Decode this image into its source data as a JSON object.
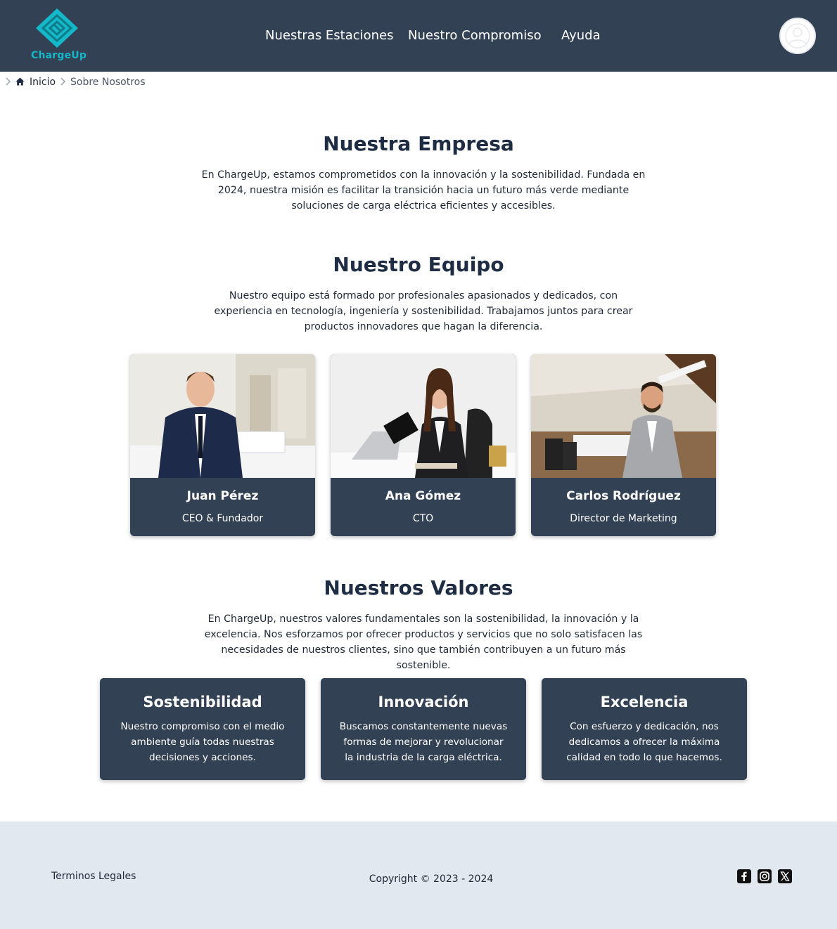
{
  "header": {
    "brand": "ChargeUp",
    "nav": [
      {
        "label": "Nuestras Estaciones"
      },
      {
        "label": "Nuestro Compromiso"
      },
      {
        "label": "Ayuda"
      }
    ]
  },
  "breadcrumb": {
    "home": "Inicio",
    "current": "Sobre Nosotros"
  },
  "company": {
    "title": "Nuestra Empresa",
    "text": "En ChargeUp, estamos comprometidos con la innovación y la sostenibilidad. Fundada en 2024, nuestra misión es facilitar la transición hacia un futuro más verde mediante soluciones de carga eléctrica eficientes y accesibles."
  },
  "team": {
    "title": "Nuestro Equipo",
    "text": "Nuestro equipo está formado por profesionales apasionados y dedicados, con experiencia en tecnología, ingeniería y sostenibilidad. Trabajamos juntos para crear productos innovadores que hagan la diferencia.",
    "members": [
      {
        "name": "Juan Pérez",
        "role": "CEO & Fundador"
      },
      {
        "name": "Ana Gómez",
        "role": "CTO"
      },
      {
        "name": "Carlos Rodríguez",
        "role": "Director de Marketing"
      }
    ]
  },
  "values": {
    "title": "Nuestros Valores",
    "text": "En ChargeUp, nuestros valores fundamentales son la sostenibilidad, la innovación y la excelencia. Nos esforzamos por ofrecer productos y servicios que no solo satisfacen las necesidades de nuestros clientes, sino que también contribuyen a un futuro más sostenible.",
    "items": [
      {
        "title": "Sostenibilidad",
        "text": "Nuestro compromiso con el medio ambiente guía todas nuestras decisiones y acciones."
      },
      {
        "title": "Innovación",
        "text": "Buscamos constantemente nuevas formas de mejorar y revolucionar la industria de la carga eléctrica."
      },
      {
        "title": "Excelencia",
        "text": "Con esfuerzo y dedicación, nos dedicamos a ofrecer la máxima calidad en todo lo que hacemos."
      }
    ]
  },
  "footer": {
    "legal": "Terminos Legales",
    "copyright": "Copyright © 2023 - 2024",
    "social": [
      "facebook-icon",
      "instagram-icon",
      "x-icon"
    ]
  },
  "colors": {
    "header_bg": "#334155",
    "brand_accent": "#14b8c8",
    "card_bg": "#334155",
    "footer_bg": "#e2e8f0"
  }
}
